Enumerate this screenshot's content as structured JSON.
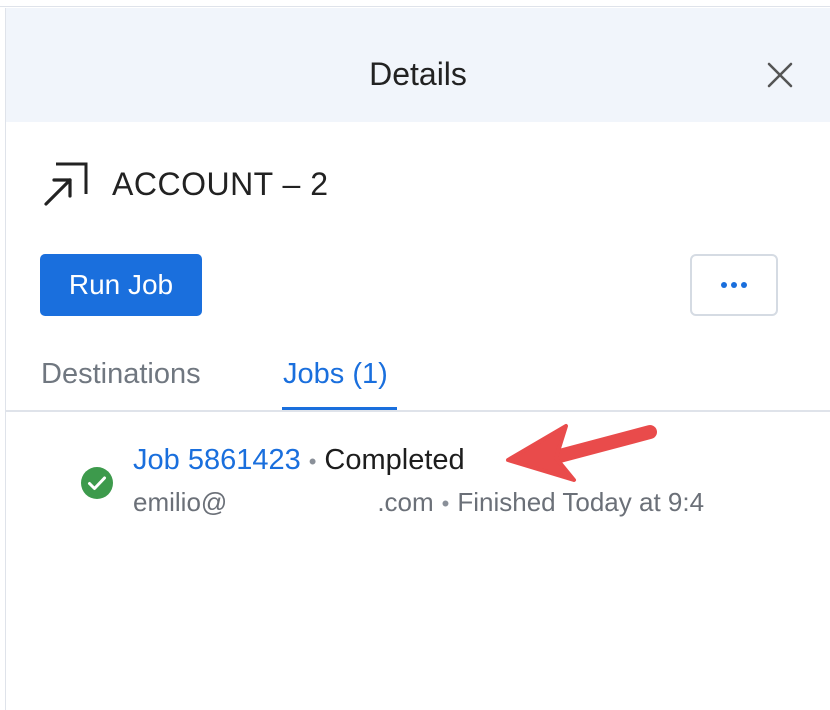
{
  "header": {
    "title": "Details",
    "close_icon": "close-icon"
  },
  "account": {
    "icon": "open-in-new-icon",
    "title": "ACCOUNT – 2"
  },
  "actions": {
    "run_job_label": "Run Job",
    "more_icon": "more-horizontal-icon"
  },
  "tabs": [
    {
      "label": "Destinations",
      "active": false
    },
    {
      "label": "Jobs (1)",
      "active": true
    }
  ],
  "job": {
    "status_icon": "check-circle-icon",
    "name": "Job 5861423",
    "separator": "•",
    "status": "Completed",
    "email_local": "emilio@",
    "email_domain": ".com",
    "finished_text": "Finished Today at 9:4"
  },
  "annotation": {
    "arrow_color": "#e94b4b"
  },
  "colors": {
    "accent": "#1a6fdd",
    "header_bg": "#f1f5fb",
    "success": "#3d9a4c"
  }
}
